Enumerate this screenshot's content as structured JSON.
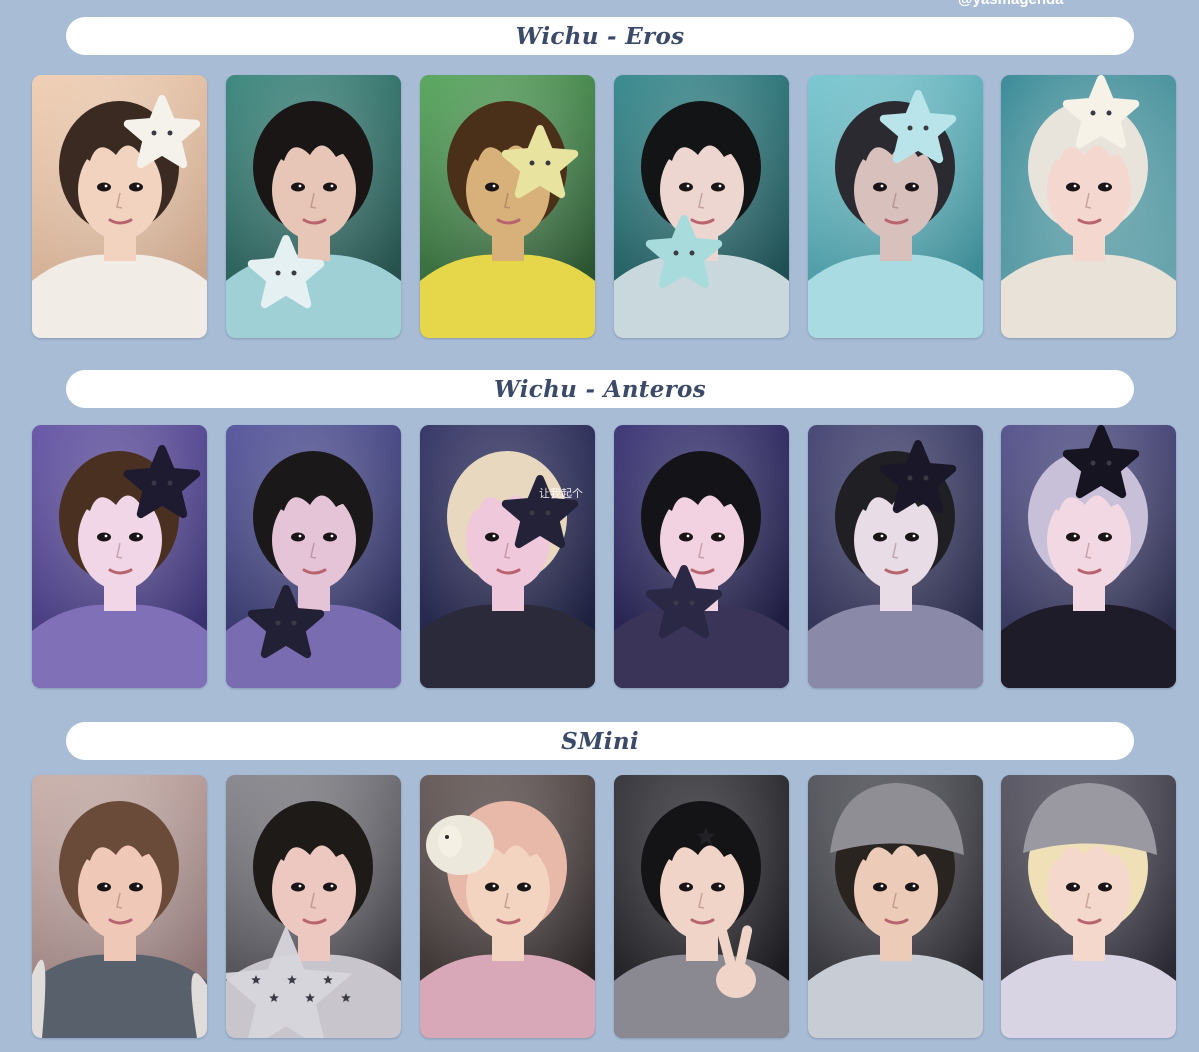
{
  "watermark": "@yasmagenda",
  "sections": [
    {
      "title": "Wichu - Eros",
      "cards": [
        {
          "bg": [
            "#f0cfb4",
            "#c8a48a"
          ],
          "hair": "#3a2a22",
          "skin": "#f2d3c0",
          "shirt": "#f1ece6",
          "plush": "#f4f2ea",
          "plush_icon": "star-plush-icon",
          "alt": "member-1"
        },
        {
          "bg": [
            "#3f8a80",
            "#26504c"
          ],
          "hair": "#1a1616",
          "skin": "#e7c6b8",
          "shirt": "#9fd0d6",
          "plush": "#e4f0f2",
          "plush_icon": "star-plush-icon",
          "alt": "member-2"
        },
        {
          "bg": [
            "#5aa860",
            "#2a5230"
          ],
          "hair": "#4a3018",
          "skin": "#d8b07a",
          "shirt": "#e6d64a",
          "plush": "#e8e4a0",
          "plush_icon": "star-plush-icon",
          "alt": "member-3"
        },
        {
          "bg": [
            "#3a8c90",
            "#1e4e52"
          ],
          "hair": "#121416",
          "skin": "#eed6d0",
          "shirt": "#c8d8dc",
          "plush": "#a8dcdc",
          "plush_icon": "star-plush-icon",
          "alt": "member-4"
        },
        {
          "bg": [
            "#7cc8d2",
            "#3c8a94"
          ],
          "hair": "#2a2a30",
          "skin": "#d8c0bc",
          "shirt": "#a8dce2",
          "plush": "#b8e4ea",
          "plush_icon": "star-plush-icon",
          "alt": "member-5"
        },
        {
          "bg": [
            "#3c8c98",
            "#6aa4ac"
          ],
          "hair": "#e8e4dc",
          "skin": "#f4d8d0",
          "shirt": "#e8e2d8",
          "plush": "#f6f2e8",
          "plush_icon": "star-plush-icon",
          "alt": "member-6"
        }
      ]
    },
    {
      "title": "Wichu - Anteros",
      "cards": [
        {
          "bg": [
            "#6a5aa8",
            "#3a3270"
          ],
          "hair": "#4a3020",
          "skin": "#f0d6e6",
          "shirt": "#8070b8",
          "plush": "#1e1a30",
          "plush_icon": "star-plush-icon",
          "alt": "member-1"
        },
        {
          "bg": [
            "#5a5aa0",
            "#2c2e58"
          ],
          "hair": "#1a1818",
          "skin": "#e6c4d8",
          "shirt": "#7a6cb0",
          "plush": "#222034",
          "plush_icon": "star-plush-icon",
          "alt": "member-2"
        },
        {
          "bg": [
            "#3a3a6a",
            "#1e2040"
          ],
          "hair": "#e8d8c0",
          "skin": "#f0c8dc",
          "shirt": "#2a2a3a",
          "plush": "#242238",
          "plush_icon": "star-plush-icon",
          "alt": "member-3",
          "caption": "让我起个"
        },
        {
          "bg": [
            "#403a7a",
            "#1e1c40"
          ],
          "hair": "#141418",
          "skin": "#f2d2e0",
          "shirt": "#3a3458",
          "plush": "#2a2844",
          "plush_icon": "star-plush-icon",
          "alt": "member-4"
        },
        {
          "bg": [
            "#4a4a78",
            "#2a2c4a"
          ],
          "hair": "#202024",
          "skin": "#e8dce6",
          "shirt": "#8a8aa8",
          "plush": "#1a1828",
          "plush_icon": "star-plush-icon",
          "alt": "member-5"
        },
        {
          "bg": [
            "#5a5890",
            "#2c2c4a"
          ],
          "hair": "#c8c0d8",
          "skin": "#f2d8e2",
          "shirt": "#1e1c28",
          "plush": "#161420",
          "plush_icon": "star-plush-icon",
          "alt": "member-6"
        }
      ]
    },
    {
      "title": "SMini",
      "cards": [
        {
          "bg": [
            "#cbb2ac",
            "#8c7474"
          ],
          "hair": "#6a4a38",
          "skin": "#f0c8b8",
          "shirt": "#58606c",
          "plush": "#e0dcda",
          "plush_icon": "hood-icon",
          "alt": "member-1"
        },
        {
          "bg": [
            "#8a8a90",
            "#3a3a40"
          ],
          "hair": "#1e1a18",
          "skin": "#ecc8c0",
          "shirt": "#c8c6cc",
          "plush": "#d8d6dc",
          "plush_icon": "star-pillow-icon",
          "alt": "member-2"
        },
        {
          "bg": [
            "#6a5e5c",
            "#2a2424"
          ],
          "hair": "#e8b8a8",
          "skin": "#f2d4c0",
          "shirt": "#d8a8b8",
          "plush": "#ece8dc",
          "plush_icon": "sheep-plush-icon",
          "alt": "member-3"
        },
        {
          "bg": [
            "#3a3a40",
            "#1a1a1e"
          ],
          "hair": "#141416",
          "skin": "#f0d4c8",
          "shirt": "#8a8890",
          "plush": "#d8d8e0",
          "plush_icon": "peace-sign-icon",
          "alt": "member-4"
        },
        {
          "bg": [
            "#5a5a62",
            "#26262c"
          ],
          "hair": "#2a2420",
          "skin": "#ecccb8",
          "shirt": "#c8ccd4",
          "plush": "#8e8e94",
          "plush_icon": "beanie-icon",
          "alt": "member-5"
        },
        {
          "bg": [
            "#5c5a66",
            "#2a2832"
          ],
          "hair": "#f0e0b8",
          "skin": "#f4d8cc",
          "shirt": "#d8d4e4",
          "plush": "#9a98a0",
          "plush_icon": "beanie-icon",
          "alt": "member-6"
        }
      ]
    }
  ]
}
